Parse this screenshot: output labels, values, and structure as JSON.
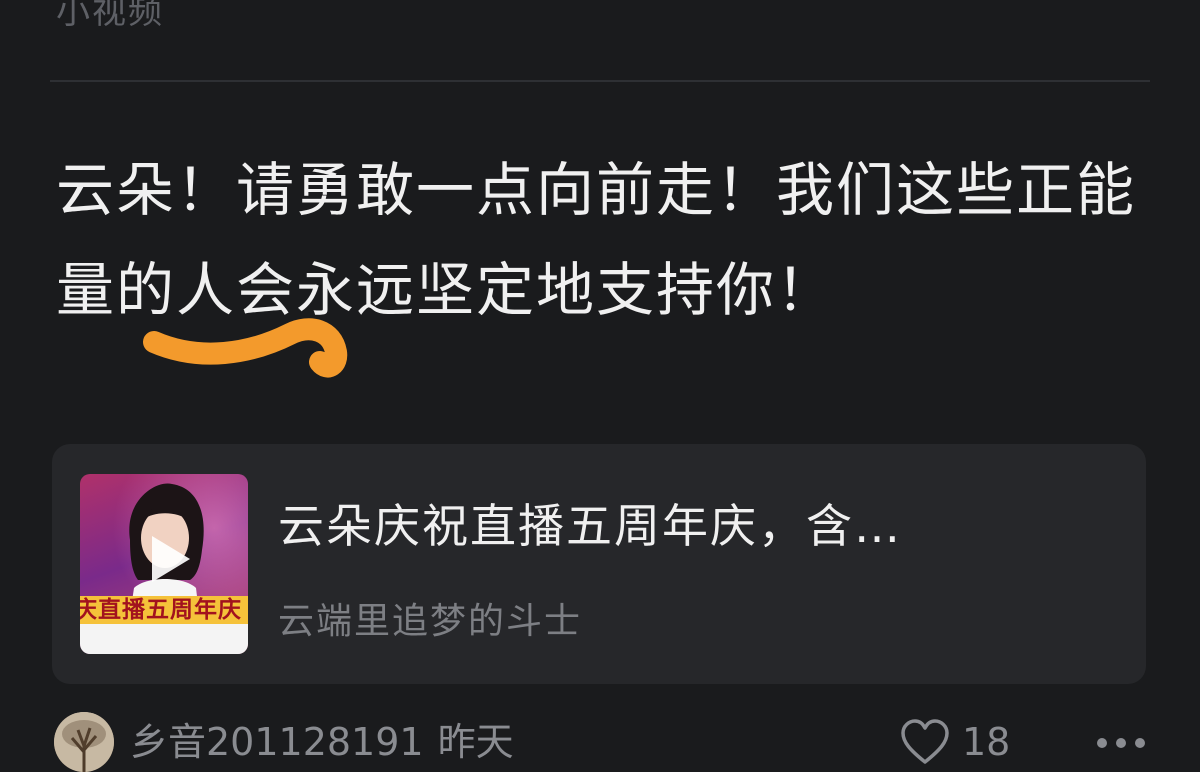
{
  "header": {
    "section_label": "小视频"
  },
  "post": {
    "text": "云朵！请勇敢一点向前走！我们这些正能量的人会永远坚定地支持你！"
  },
  "video_card": {
    "title": "云朵庆祝直播五周年庆，含…",
    "author": "云端里追梦的斗士",
    "thumbnail_caption": "庆直播五周年庆"
  },
  "footer": {
    "username": "乡音201128191",
    "time": "昨天",
    "like_count": "18"
  },
  "colors": {
    "background": "#1a1b1d",
    "card_background": "#26272a",
    "highlight_stroke": "#f39a2c",
    "muted_text": "#8a8c91"
  }
}
